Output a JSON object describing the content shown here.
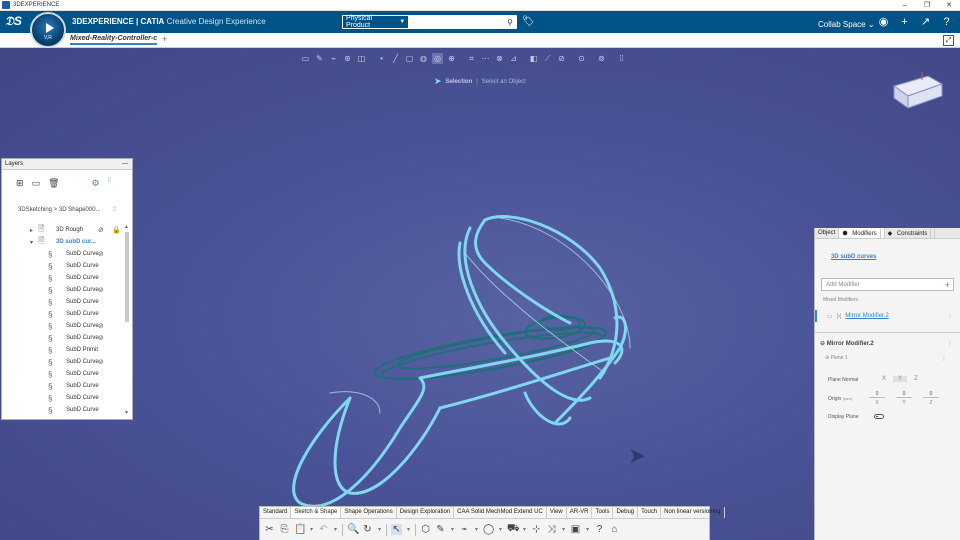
{
  "window": {
    "title": "3DEXPERIENCE"
  },
  "topbar": {
    "brand_main": "3DEXPERIENCE | CATIA",
    "brand_sub": "Creative Design Experience",
    "compass_label": "V,R",
    "search_context": "Physical Product",
    "search_value": "",
    "collab_space": "Collab Space"
  },
  "tabs": [
    {
      "label": "Mixed-Reality-Controller-c"
    }
  ],
  "viewport": {
    "selection_label": "Selection",
    "selection_hint": "Select an Object"
  },
  "layers": {
    "title": "Layers",
    "breadcrumb": "3DSketching > 3D Shape000...",
    "items": [
      {
        "label": "3D Rough",
        "level": 1,
        "hidden": true,
        "locked": true,
        "selected": false
      },
      {
        "label": "3D subD cur...",
        "level": 1,
        "hidden": false,
        "locked": false,
        "selected": true
      },
      {
        "label": "SubD Curve",
        "level": 2,
        "hidden": true
      },
      {
        "label": "SubD Curve",
        "level": 2,
        "hidden": false
      },
      {
        "label": "SubD Curve",
        "level": 2,
        "hidden": false
      },
      {
        "label": "SubD Curve",
        "level": 2,
        "hidden": true
      },
      {
        "label": "SubD Curve",
        "level": 2,
        "hidden": false
      },
      {
        "label": "SubD Curve",
        "level": 2,
        "hidden": false
      },
      {
        "label": "SubD Curve",
        "level": 2,
        "hidden": true
      },
      {
        "label": "SubD Curve",
        "level": 2,
        "hidden": true
      },
      {
        "label": "SubD Primit",
        "level": 2,
        "hidden": false
      },
      {
        "label": "SubD Curve",
        "level": 2,
        "hidden": true
      },
      {
        "label": "SubD Curve",
        "level": 2,
        "hidden": false
      },
      {
        "label": "SubD Curve",
        "level": 2,
        "hidden": false
      },
      {
        "label": "SubD Curve",
        "level": 2,
        "hidden": false
      },
      {
        "label": "SubD Curve",
        "level": 2,
        "hidden": false
      }
    ]
  },
  "properties": {
    "tabs": [
      "Object",
      "Modifiers",
      "Constraints"
    ],
    "active_tab": "Modifiers",
    "target": "3D subD curves",
    "add_placeholder": "Add Modifier",
    "section_label": "Mixed Modifiers",
    "modifier_name": "Mirror Modifier.2",
    "detail_title": "Mirror Modifier.2",
    "plane_label": "Plane 1",
    "plane_normal_label": "Plane Normal",
    "axes": [
      "X",
      "Y",
      "Z"
    ],
    "active_axis": "Y",
    "origin_label": "Origin",
    "origin_unit": "(mm)",
    "origin_values": [
      "0",
      "0",
      "0"
    ],
    "display_plane_label": "Display Plane",
    "display_plane_on": false
  },
  "action_bar": {
    "tabs": [
      "Standard",
      "Sketch & Shape",
      "Shape Operations",
      "Design Exploration",
      "CAA Solid MechMod Extend UC",
      "View",
      "AR-VR",
      "Tools",
      "Debug",
      "Touch",
      "Non linear versioning"
    ],
    "active_tab": "Sketch & Shape"
  },
  "colors": {
    "topbar": "#005386",
    "viewport": "#4a5398",
    "curve": "#7fd8f0",
    "accent": "#3a83c7"
  }
}
